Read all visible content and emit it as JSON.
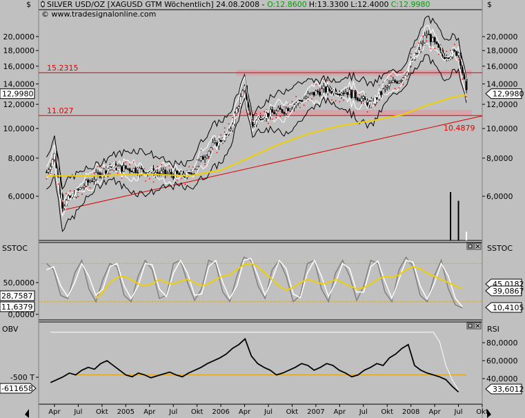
{
  "header": {
    "symbol_icon": "candlestick-icon",
    "title": "SILVER USD/OZ [XAGUSD GTM  Wöchentlich] 24.08.2008 - ",
    "open": "O:12.8600",
    "high": "H:13.3300",
    "low": "L:12.4000",
    "close": "C:12.9980",
    "copyright": "© www.tradesignalonline.com",
    "colors": {
      "open": "#00a000",
      "close": "#00a000",
      "text": "#000000"
    }
  },
  "axis_marks": {
    "left_dollar": "$",
    "right_dollar": "$"
  },
  "chart_data": [
    {
      "type": "candlestick",
      "panel": "price",
      "title": "SILVER USD/OZ",
      "yscale": "log",
      "ylim": [
        4.3,
        24.5
      ],
      "y_ticks": [
        "20,0000",
        "18,0000",
        "16,0000",
        "14,0000",
        "12,0000",
        "10,0000",
        "8,0000",
        "6,0000"
      ],
      "y_tick_values": [
        20,
        18,
        16,
        14,
        12,
        10,
        8,
        6
      ],
      "x_ticks": [
        "Apr",
        "Jul",
        "Okt",
        "2005",
        "Apr",
        "Jul",
        "Okt",
        "2006",
        "Apr",
        "Jul",
        "Okt",
        "2007",
        "Apr",
        "Jul",
        "Okt",
        "2008",
        "Apr",
        "Jul",
        "Okt"
      ],
      "last_price_label": "12,9980",
      "last_price": 12.998,
      "key_points": {
        "x": [
          "2004-03",
          "2004-04",
          "2004-05",
          "2004-08",
          "2004-11",
          "2005-03",
          "2005-06",
          "2005-09",
          "2005-12",
          "2006-02",
          "2006-04",
          "2006-05",
          "2006-06",
          "2006-09",
          "2006-12",
          "2007-02",
          "2007-05",
          "2007-08",
          "2007-10",
          "2007-12",
          "2008-02",
          "2008-03",
          "2008-05",
          "2008-07",
          "2008-08"
        ],
        "close": [
          7.2,
          8.2,
          5.6,
          6.6,
          7.5,
          7.3,
          7.1,
          7.0,
          8.8,
          9.6,
          13.5,
          10.2,
          11.0,
          11.5,
          12.8,
          13.4,
          13.2,
          12.0,
          13.7,
          14.8,
          18.0,
          20.5,
          17.3,
          17.8,
          13.0
        ]
      },
      "horizontal_lines": [
        {
          "label": "15.2315",
          "value": 15.2315,
          "color": "#e00000"
        },
        {
          "label": "11.027",
          "value": 11.027,
          "color": "#e00000"
        }
      ],
      "trendline": {
        "label": "10.4879",
        "value_at_end": 10.4879,
        "color": "#e00000"
      },
      "zones": [
        {
          "from": 14.9,
          "to": 15.55,
          "color": "#d8a0a8"
        },
        {
          "from": 11.0,
          "to": 11.5,
          "color": "#d8a0a8"
        }
      ],
      "moving_average_color": "#f0d000",
      "moving_average": {
        "x": [
          "2004-03",
          "2004-09",
          "2005-03",
          "2005-09",
          "2006-01",
          "2006-04",
          "2006-08",
          "2006-12",
          "2007-04",
          "2007-08",
          "2007-12",
          "2008-03",
          "2008-06",
          "2008-08"
        ],
        "values": [
          7.0,
          7.0,
          7.1,
          7.0,
          7.3,
          7.9,
          8.8,
          9.6,
          10.2,
          10.6,
          11.1,
          11.9,
          12.6,
          12.9
        ]
      },
      "volume_bars": {
        "x": [
          "2008-06",
          "2008-07",
          "2008-08"
        ],
        "values": [
          100,
          82,
          18
        ]
      }
    },
    {
      "type": "line",
      "panel": "sstoc",
      "title": "SSTOC",
      "ylim": [
        0,
        100
      ],
      "y_ticks": [
        "50,0000",
        "0,0000"
      ],
      "y_tick_values": [
        50,
        0
      ],
      "left_labels": [
        "28,7587",
        "11,6379"
      ],
      "right_labels": [
        "45,0182",
        "39,0867",
        "10,4105"
      ],
      "reference_lines": [
        80,
        20
      ],
      "reference_color": "#e0a000",
      "series": [
        {
          "color": "#808080",
          "values": [
            80,
            70,
            30,
            25,
            65,
            85,
            40,
            20,
            55,
            80,
            75,
            30,
            20,
            60,
            85,
            70,
            25,
            30,
            80,
            85,
            50,
            22,
            40,
            85,
            80,
            35,
            20,
            60,
            90,
            85,
            45,
            25,
            70,
            85,
            60,
            20,
            30,
            80,
            85,
            40,
            20,
            65,
            85,
            60,
            22,
            45,
            85,
            80,
            35,
            20,
            70,
            90,
            75,
            30,
            20,
            60,
            85,
            40,
            15,
            10
          ]
        },
        {
          "color": "#ffffff",
          "values": [
            70,
            75,
            45,
            28,
            50,
            80,
            60,
            30,
            40,
            75,
            80,
            45,
            25,
            45,
            80,
            78,
            40,
            28,
            65,
            85,
            65,
            30,
            32,
            75,
            85,
            50,
            25,
            45,
            85,
            88,
            60,
            30,
            55,
            85,
            72,
            32,
            26,
            65,
            85,
            60,
            28,
            50,
            80,
            72,
            35,
            35,
            75,
            84,
            52,
            25,
            55,
            85,
            82,
            45,
            24,
            48,
            80,
            60,
            25,
            12
          ]
        },
        {
          "color": "#f0d000",
          "values": [
            null,
            null,
            null,
            null,
            null,
            null,
            null,
            25,
            35,
            50,
            58,
            60,
            55,
            48,
            45,
            48,
            55,
            50,
            48,
            52,
            55,
            50,
            45,
            48,
            55,
            60,
            62,
            70,
            78,
            80,
            75,
            65,
            55,
            45,
            38,
            42,
            50,
            55,
            52,
            48,
            50,
            55,
            50,
            45,
            40,
            42,
            48,
            55,
            60,
            58,
            62,
            70,
            75,
            72,
            65,
            60,
            55,
            50,
            45,
            40
          ]
        }
      ]
    },
    {
      "type": "line",
      "panel": "obv_rsi",
      "title": "OBV",
      "right_title": "RSI",
      "y_ticks_left": [
        "-500 T"
      ],
      "y_ticks_right": [
        "80,0000",
        "60,0000",
        "40,0000"
      ],
      "y_tick_values_right": [
        80,
        60,
        40
      ],
      "left_label": "-611658",
      "right_label": "33,6012",
      "reference_line": 50,
      "reference_color": "#e0a000",
      "series": [
        {
          "name": "",
          "color": "#000000",
          "values": [
            42,
            45,
            48,
            52,
            50,
            55,
            58,
            56,
            62,
            65,
            60,
            55,
            50,
            48,
            52,
            50,
            47,
            49,
            51,
            53,
            50,
            48,
            52,
            55,
            58,
            62,
            65,
            68,
            72,
            78,
            82,
            88,
            70,
            62,
            58,
            55,
            50,
            52,
            55,
            58,
            62,
            60,
            55,
            58,
            62,
            60,
            55,
            52,
            48,
            50,
            55,
            58,
            62,
            60,
            68,
            72,
            78,
            82,
            60,
            55,
            52,
            50,
            48,
            45,
            38,
            32
          ]
        },
        {
          "name": "",
          "color": "#ffffff",
          "values": [
            95,
            95,
            95,
            95,
            95,
            95,
            95,
            95,
            95,
            95,
            95,
            95,
            95,
            95,
            95,
            95,
            95,
            95,
            95,
            95,
            95,
            95,
            95,
            95,
            95,
            95,
            95,
            95,
            95,
            95,
            95,
            95,
            95,
            95,
            95,
            95,
            95,
            95,
            95,
            95,
            95,
            95,
            95,
            95,
            95,
            95,
            95,
            95,
            95,
            95,
            95,
            95,
            95,
            95,
            95,
            95,
            95,
            95,
            95,
            95,
            95,
            95,
            85,
            60,
            45,
            34
          ]
        }
      ]
    }
  ]
}
